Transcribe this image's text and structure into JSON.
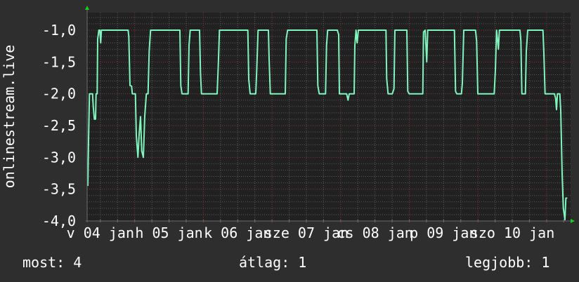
{
  "chart_data": {
    "type": "line",
    "ylabel": "onlinestream.live",
    "ylim": [
      -4.0,
      -0.75
    ],
    "yticks": [
      {
        "value": -1.0,
        "label": "-1,0"
      },
      {
        "value": -1.5,
        "label": "-1,5"
      },
      {
        "value": -2.0,
        "label": "-2,0"
      },
      {
        "value": -2.5,
        "label": "-2,5"
      },
      {
        "value": -3.0,
        "label": "-3,0"
      },
      {
        "value": -3.5,
        "label": "-3,5"
      },
      {
        "value": -4.0,
        "label": "-4,0"
      }
    ],
    "xlim": [
      "01-04 07:22",
      "01-11 08:30"
    ],
    "xticks": [
      {
        "at": "01-04 12:00",
        "label": "v 04 jan"
      },
      {
        "at": "01-05 12:00",
        "label": "h 05 jan"
      },
      {
        "at": "01-06 12:00",
        "label": "k 06 jan"
      },
      {
        "at": "01-07 12:00",
        "label": "sze 07 jan"
      },
      {
        "at": "01-08 12:00",
        "label": "cs 08 jan"
      },
      {
        "at": "01-09 12:00",
        "label": "p 09 jan"
      },
      {
        "at": "01-10 12:00",
        "label": "szo 10 jan"
      }
    ],
    "grid": true,
    "colors": {
      "line": "#7ff5bd",
      "plot_bg": "#212121",
      "minor_grid": "#5a5a5a",
      "major_grid": "#7a3a3a",
      "arrow": "#18d018"
    },
    "points": [
      [
        "01-04 07:37",
        -3.45
      ],
      [
        "01-04 07:52",
        -2.74
      ],
      [
        "01-04 08:11",
        -2.0
      ],
      [
        "01-04 09:16",
        -2.0
      ],
      [
        "01-04 09:30",
        -2.2
      ],
      [
        "01-04 09:54",
        -2.4
      ],
      [
        "01-04 10:19",
        -2.4
      ],
      [
        "01-04 10:29",
        -2.0
      ],
      [
        "01-04 10:53",
        -2.0
      ],
      [
        "01-04 11:03",
        -1.14
      ],
      [
        "01-04 11:28",
        -1.0
      ],
      [
        "01-04 11:47",
        -1.0
      ],
      [
        "01-04 12:07",
        -1.2
      ],
      [
        "01-04 12:21",
        -1.0
      ],
      [
        "01-04 21:41",
        -1.0
      ],
      [
        "01-04 21:56",
        -1.1
      ],
      [
        "01-04 22:21",
        -1.87
      ],
      [
        "01-04 22:55",
        -1.88
      ],
      [
        "01-04 23:10",
        -2.0
      ],
      [
        "01-05 00:15",
        -2.0
      ],
      [
        "01-05 00:34",
        -2.66
      ],
      [
        "01-05 01:08",
        -3.0
      ],
      [
        "01-05 01:33",
        -2.64
      ],
      [
        "01-05 02:02",
        -2.36
      ],
      [
        "01-05 02:27",
        -2.9
      ],
      [
        "01-05 03:01",
        -3.0
      ],
      [
        "01-05 03:31",
        -2.35
      ],
      [
        "01-05 04:05",
        -2.0
      ],
      [
        "01-05 04:40",
        -2.0
      ],
      [
        "01-05 05:04",
        -1.33
      ],
      [
        "01-05 05:33",
        -1.0
      ],
      [
        "01-05 15:48",
        -1.0
      ],
      [
        "01-05 16:07",
        -1.87
      ],
      [
        "01-05 16:32",
        -2.0
      ],
      [
        "01-05 18:40",
        -2.0
      ],
      [
        "01-05 18:59",
        -1.24
      ],
      [
        "01-05 19:24",
        -1.0
      ],
      [
        "01-05 22:40",
        -1.0
      ],
      [
        "01-05 22:59",
        -1.66
      ],
      [
        "01-05 23:20",
        -2.0
      ],
      [
        "01-06 04:49",
        -2.0
      ],
      [
        "01-06 05:14",
        -1.54
      ],
      [
        "01-06 05:38",
        -1.0
      ],
      [
        "01-06 15:33",
        -1.0
      ],
      [
        "01-06 15:52",
        -1.77
      ],
      [
        "01-06 16:22",
        -2.0
      ],
      [
        "01-06 18:20",
        -2.0
      ],
      [
        "01-06 18:39",
        -1.65
      ],
      [
        "01-06 19:08",
        -1.0
      ],
      [
        "01-06 22:45",
        -1.0
      ],
      [
        "01-06 22:59",
        -1.46
      ],
      [
        "01-06 23:25",
        -2.0
      ],
      [
        "01-07 04:38",
        -2.0
      ],
      [
        "01-07 04:58",
        -1.14
      ],
      [
        "01-07 05:27",
        -1.0
      ],
      [
        "01-07 15:42",
        -1.0
      ],
      [
        "01-07 16:01",
        -1.87
      ],
      [
        "01-07 16:31",
        -2.0
      ],
      [
        "01-07 18:43",
        -2.0
      ],
      [
        "01-07 19:04",
        -1.24
      ],
      [
        "01-07 19:27",
        -1.0
      ],
      [
        "01-07 22:49",
        -1.0
      ],
      [
        "01-07 23:19",
        -1.07
      ],
      [
        "01-07 23:34",
        -2.0
      ],
      [
        "01-08 02:05",
        -2.0
      ],
      [
        "01-08 02:35",
        -2.1
      ],
      [
        "01-08 03:00",
        -2.0
      ],
      [
        "01-08 04:43",
        -2.0
      ],
      [
        "01-08 04:58",
        -1.24
      ],
      [
        "01-08 05:23",
        -1.0
      ],
      [
        "01-08 05:46",
        -1.2
      ],
      [
        "01-08 06:11",
        -1.0
      ],
      [
        "01-08 15:50",
        -1.0
      ],
      [
        "01-08 16:05",
        -1.76
      ],
      [
        "01-08 16:35",
        -2.0
      ],
      [
        "01-08 18:04",
        -2.0
      ],
      [
        "01-08 18:39",
        -1.92
      ],
      [
        "01-08 18:58",
        -1.0
      ],
      [
        "01-08 23:08",
        -1.0
      ],
      [
        "01-08 23:28",
        -1.96
      ],
      [
        "01-08 23:57",
        -2.0
      ],
      [
        "01-09 04:43",
        -2.0
      ],
      [
        "01-09 04:58",
        -1.03
      ],
      [
        "01-09 05:32",
        -1.0
      ],
      [
        "01-09 06:05",
        -1.5
      ],
      [
        "01-09 06:26",
        -1.0
      ],
      [
        "01-09 15:46",
        -1.0
      ],
      [
        "01-09 16:10",
        -1.96
      ],
      [
        "01-09 16:35",
        -2.0
      ],
      [
        "01-09 18:14",
        -2.0
      ],
      [
        "01-09 18:33",
        -1.83
      ],
      [
        "01-09 19:02",
        -1.0
      ],
      [
        "01-09 23:08",
        -1.0
      ],
      [
        "01-09 23:32",
        -1.17
      ],
      [
        "01-09 23:57",
        -2.0
      ],
      [
        "01-10 05:40",
        -2.0
      ],
      [
        "01-10 06:05",
        -1.63
      ],
      [
        "01-10 06:31",
        -1.0
      ],
      [
        "01-10 07:09",
        -1.3
      ],
      [
        "01-10 07:29",
        -1.0
      ],
      [
        "01-10 14:41",
        -1.0
      ],
      [
        "01-10 15:01",
        -1.17
      ],
      [
        "01-10 15:21",
        -2.0
      ],
      [
        "01-10 16:35",
        -2.0
      ],
      [
        "01-10 16:54",
        -1.33
      ],
      [
        "01-10 17:23",
        -1.0
      ],
      [
        "01-10 22:43",
        -1.0
      ],
      [
        "01-10 23:02",
        -1.36
      ],
      [
        "01-10 23:28",
        -2.0
      ],
      [
        "01-11 02:44",
        -2.0
      ],
      [
        "01-11 03:09",
        -2.07
      ],
      [
        "01-11 03:28",
        -2.25
      ],
      [
        "01-11 03:47",
        -2.0
      ],
      [
        "01-11 04:37",
        -2.0
      ],
      [
        "01-11 04:56",
        -2.26
      ],
      [
        "01-11 05:26",
        -3.26
      ],
      [
        "01-11 05:51",
        -3.8
      ],
      [
        "01-11 06:25",
        -3.98
      ],
      [
        "01-11 06:44",
        -3.64
      ],
      [
        "01-11 07:13",
        -3.64
      ]
    ]
  },
  "footer": {
    "current": "most: 4",
    "average": "átlag: 1",
    "best": "legjobb: 1"
  }
}
